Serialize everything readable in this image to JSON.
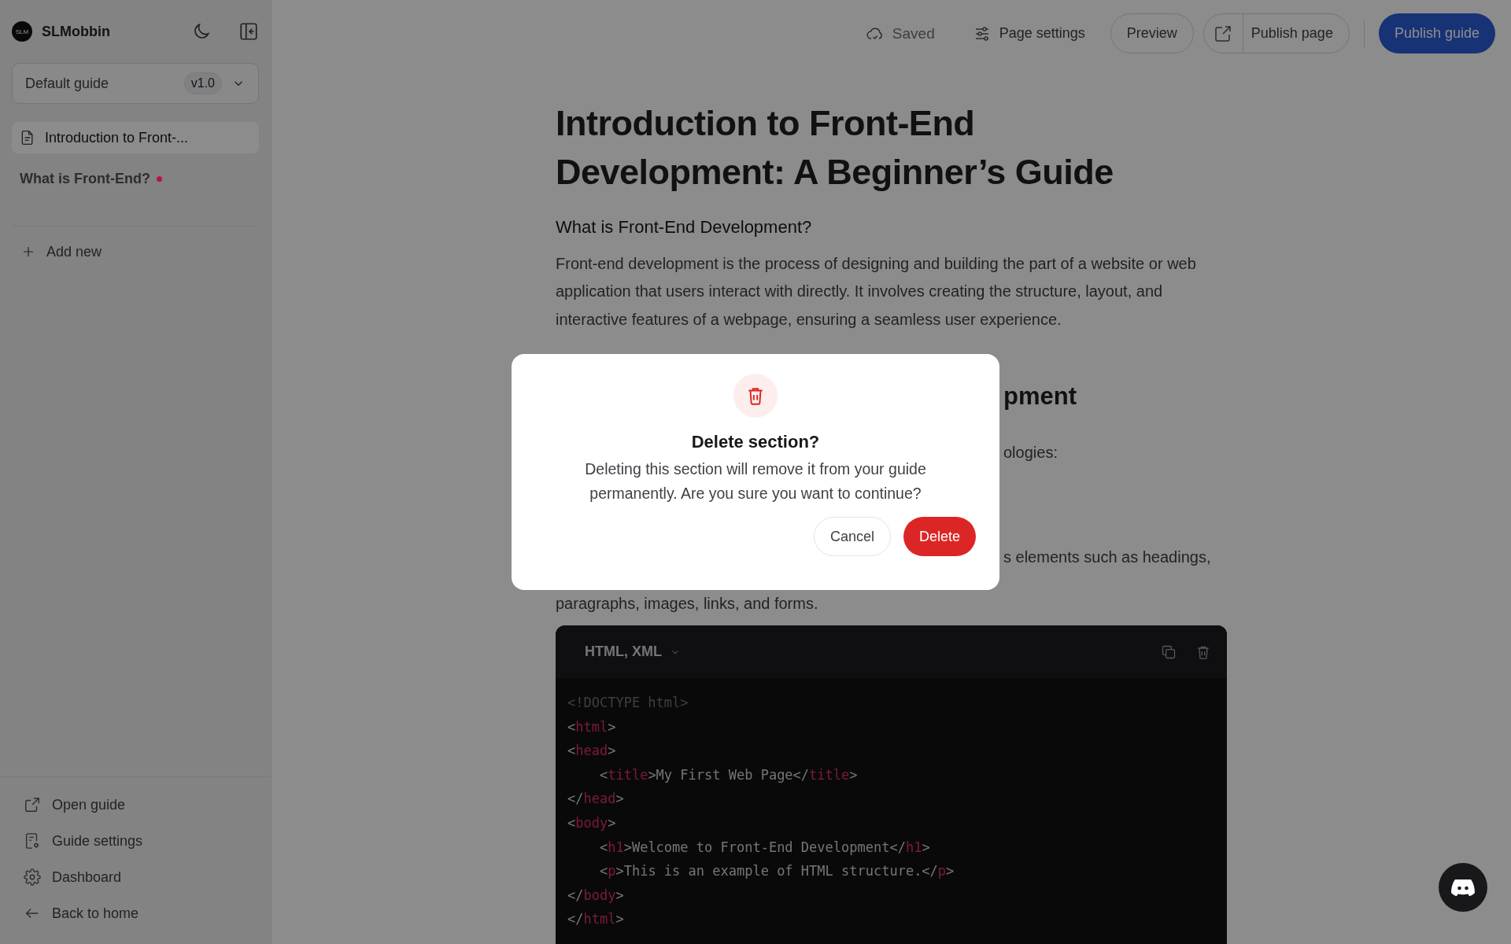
{
  "sidebar": {
    "brand": {
      "logo": "SLM",
      "name": "SLMobbin"
    },
    "guide_select": {
      "value": "Default guide",
      "version": "v1.0"
    },
    "pages": [
      {
        "kind": "page",
        "label": "Introduction to Front-...",
        "selected": true
      },
      {
        "kind": "section",
        "label": "What is Front-End?",
        "selected": false,
        "color": "#b4154a"
      }
    ],
    "add_new": "Add new",
    "footer_links": [
      {
        "kind": "open",
        "label": "Open guide"
      },
      {
        "kind": "guide-settings",
        "label": "Guide settings"
      },
      {
        "kind": "dashboard",
        "label": "Dashboard"
      },
      {
        "kind": "back",
        "label": "Back to home"
      }
    ]
  },
  "toolbar": {
    "status": "Saved",
    "page_settings": "Page settings",
    "preview": "Preview",
    "publish_page": "Publish page",
    "publish_guide": "Publish guide"
  },
  "article": {
    "title": "Introduction to Front-End Development: A Beginner’s Guide",
    "subtitle": "What is Front-End Development?",
    "paragraph": "Front-end development is the process of designing and building the part of a website or web application that users interact with directly. It involves creating the structure, layout, and interactive features of a webpage, ensuring a seamless user experience.",
    "covered_fragments": [
      {
        "kind": "heading",
        "text": "pment"
      },
      {
        "kind": "body",
        "text": "ologies:"
      },
      {
        "kind": "body",
        "text": "s elements such as headings,"
      }
    ],
    "paragraph_2": "paragraphs, images, links, and forms.",
    "code_block": {
      "language": "HTML, XML",
      "lines": [
        [
          {
            "kind": "doctype",
            "text": "<!DOCTYPE html>"
          }
        ],
        [
          {
            "kind": "punct",
            "text": "<"
          },
          {
            "kind": "tag",
            "text": "html"
          },
          {
            "kind": "punct",
            "text": ">"
          }
        ],
        [
          {
            "kind": "punct",
            "text": "<"
          },
          {
            "kind": "tag",
            "text": "head"
          },
          {
            "kind": "punct",
            "text": ">"
          }
        ],
        [
          {
            "kind": "punct",
            "text": "    <"
          },
          {
            "kind": "tag",
            "text": "title"
          },
          {
            "kind": "punct",
            "text": ">My First Web Page</"
          },
          {
            "kind": "tag",
            "text": "title"
          },
          {
            "kind": "punct",
            "text": ">"
          }
        ],
        [
          {
            "kind": "punct",
            "text": "</"
          },
          {
            "kind": "tag",
            "text": "head"
          },
          {
            "kind": "punct",
            "text": ">"
          }
        ],
        [
          {
            "kind": "punct",
            "text": "<"
          },
          {
            "kind": "tag",
            "text": "body"
          },
          {
            "kind": "punct",
            "text": ">"
          }
        ],
        [
          {
            "kind": "punct",
            "text": "    <"
          },
          {
            "kind": "tag",
            "text": "h1"
          },
          {
            "kind": "punct",
            "text": ">Welcome to Front-End Development</"
          },
          {
            "kind": "tag",
            "text": "h1"
          },
          {
            "kind": "punct",
            "text": ">"
          }
        ],
        [
          {
            "kind": "punct",
            "text": "    <"
          },
          {
            "kind": "tag",
            "text": "p"
          },
          {
            "kind": "punct",
            "text": ">This is an example of HTML structure.</"
          },
          {
            "kind": "tag",
            "text": "p"
          },
          {
            "kind": "punct",
            "text": ">"
          }
        ],
        [
          {
            "kind": "punct",
            "text": "</"
          },
          {
            "kind": "tag",
            "text": "body"
          },
          {
            "kind": "punct",
            "text": ">"
          }
        ],
        [
          {
            "kind": "punct",
            "text": "</"
          },
          {
            "kind": "tag",
            "text": "html"
          },
          {
            "kind": "punct",
            "text": ">"
          }
        ]
      ]
    }
  },
  "dialog": {
    "title": "Delete section?",
    "message": "Deleting this section will remove it from your guide permanently. Are you sure you want to continue?",
    "buttons": [
      {
        "kind": "secondary",
        "label": "Cancel"
      },
      {
        "kind": "danger",
        "label": "Delete"
      }
    ]
  }
}
